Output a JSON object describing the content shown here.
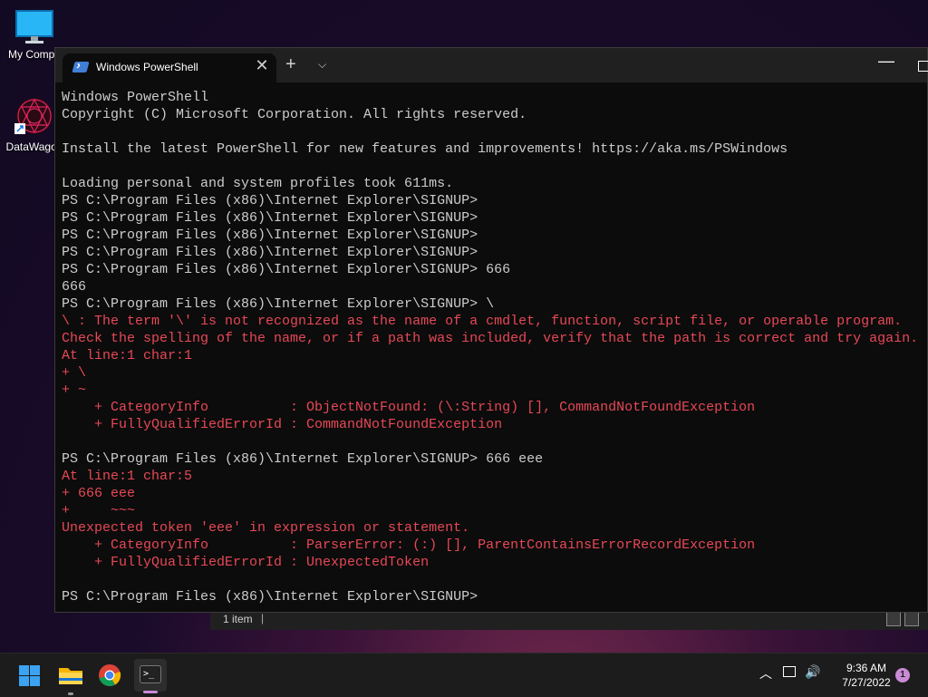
{
  "desktop": {
    "icons": [
      {
        "label": "My Compu"
      },
      {
        "label": "DataWagon"
      }
    ]
  },
  "explorer_status": {
    "item_count": "1 item",
    "separator": "|"
  },
  "terminal": {
    "tab_title": "Windows PowerShell",
    "tab_close": "✕",
    "new_tab": "+",
    "tab_menu": "⌵",
    "minimize": "—",
    "lines": [
      {
        "text": "Windows PowerShell",
        "type": "ok"
      },
      {
        "text": "Copyright (C) Microsoft Corporation. All rights reserved.",
        "type": "ok"
      },
      {
        "text": "",
        "type": "ok"
      },
      {
        "text": "Install the latest PowerShell for new features and improvements! https://aka.ms/PSWindows",
        "type": "ok"
      },
      {
        "text": "",
        "type": "ok"
      },
      {
        "text": "Loading personal and system profiles took 611ms.",
        "type": "ok"
      },
      {
        "text": "PS C:\\Program Files (x86)\\Internet Explorer\\SIGNUP>",
        "type": "ok"
      },
      {
        "text": "PS C:\\Program Files (x86)\\Internet Explorer\\SIGNUP>",
        "type": "ok"
      },
      {
        "text": "PS C:\\Program Files (x86)\\Internet Explorer\\SIGNUP>",
        "type": "ok"
      },
      {
        "text": "PS C:\\Program Files (x86)\\Internet Explorer\\SIGNUP>",
        "type": "ok"
      },
      {
        "text": "PS C:\\Program Files (x86)\\Internet Explorer\\SIGNUP> 666",
        "type": "ok"
      },
      {
        "text": "666",
        "type": "ok"
      },
      {
        "text": "PS C:\\Program Files (x86)\\Internet Explorer\\SIGNUP> \\",
        "type": "ok"
      },
      {
        "text": "\\ : The term '\\' is not recognized as the name of a cmdlet, function, script file, or operable program.",
        "type": "err"
      },
      {
        "text": "Check the spelling of the name, or if a path was included, verify that the path is correct and try again.",
        "type": "err"
      },
      {
        "text": "At line:1 char:1",
        "type": "err"
      },
      {
        "text": "+ \\",
        "type": "err"
      },
      {
        "text": "+ ~",
        "type": "err"
      },
      {
        "text": "    + CategoryInfo          : ObjectNotFound: (\\:String) [], CommandNotFoundException",
        "type": "err"
      },
      {
        "text": "    + FullyQualifiedErrorId : CommandNotFoundException",
        "type": "err"
      },
      {
        "text": "",
        "type": "ok"
      },
      {
        "text": "PS C:\\Program Files (x86)\\Internet Explorer\\SIGNUP> 666 eee",
        "type": "ok"
      },
      {
        "text": "At line:1 char:5",
        "type": "err"
      },
      {
        "text": "+ 666 eee",
        "type": "err"
      },
      {
        "text": "+     ~~~",
        "type": "err"
      },
      {
        "text": "Unexpected token 'eee' in expression or statement.",
        "type": "err"
      },
      {
        "text": "    + CategoryInfo          : ParserError: (:) [], ParentContainsErrorRecordException",
        "type": "err"
      },
      {
        "text": "    + FullyQualifiedErrorId : UnexpectedToken",
        "type": "err"
      },
      {
        "text": "",
        "type": "ok"
      },
      {
        "text": "PS C:\\Program Files (x86)\\Internet Explorer\\SIGNUP>",
        "type": "ok"
      }
    ]
  },
  "taskbar": {
    "tray": {
      "chevron": "︿",
      "volume": "🔊",
      "time": "9:36 AM",
      "date": "7/27/2022",
      "notification_count": "1"
    }
  }
}
